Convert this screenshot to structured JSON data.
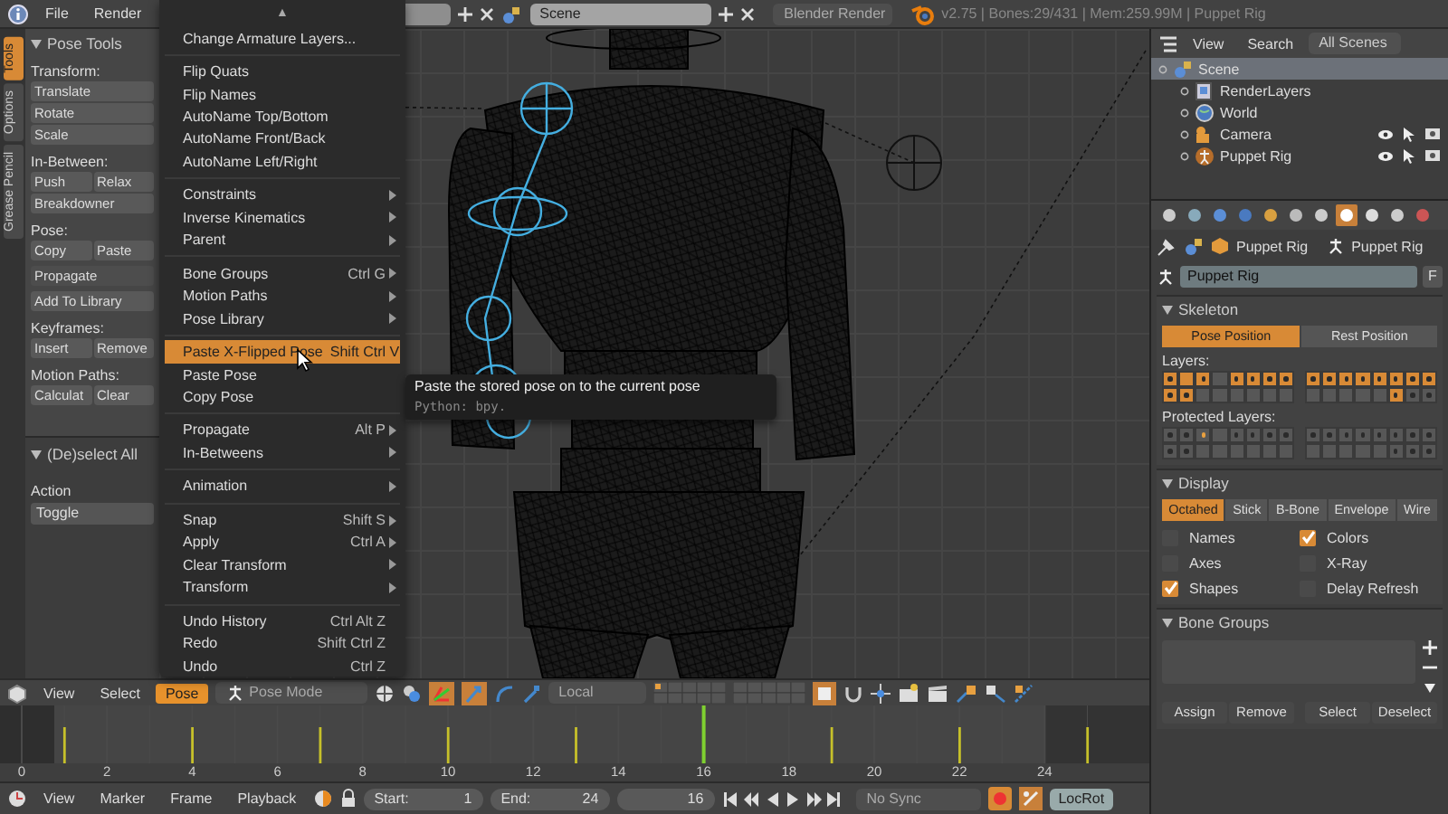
{
  "top_bar": {
    "menus": [
      "File",
      "Render"
    ],
    "scene": "Scene",
    "render_engine": "Blender Render",
    "stats": "v2.75 | Bones:29/431 | Mem:259.99M | Puppet Rig"
  },
  "tool_shelf": {
    "tabs": [
      {
        "label": "Tools",
        "selected": true
      },
      {
        "label": "Options",
        "selected": false
      },
      {
        "label": "Grease Pencil",
        "selected": false
      }
    ],
    "title": "Pose Tools",
    "sections": [
      {
        "label": "Transform:",
        "rows": [
          {
            "kind": "buttons",
            "buttons": [
              "Translate"
            ]
          },
          {
            "kind": "buttons",
            "buttons": [
              "Rotate"
            ]
          },
          {
            "kind": "buttons",
            "buttons": [
              "Scale"
            ]
          }
        ]
      },
      {
        "label": "In-Between:",
        "rows": [
          {
            "kind": "buttons",
            "buttons": [
              "Push",
              "Relax"
            ]
          },
          {
            "kind": "buttons",
            "buttons": [
              "Breakdowner"
            ]
          }
        ]
      },
      {
        "label": "Pose:",
        "rows": [
          {
            "kind": "buttons",
            "buttons": [
              "Copy",
              "Paste"
            ]
          },
          {
            "kind": "dropdown",
            "buttons": [
              "Propagate"
            ]
          },
          {
            "kind": "buttons",
            "buttons": [
              "Add To Library"
            ]
          }
        ]
      },
      {
        "label": "Keyframes:",
        "rows": [
          {
            "kind": "buttons",
            "buttons": [
              "Insert",
              "Remove"
            ]
          }
        ]
      },
      {
        "label": "Motion Paths:",
        "rows": [
          {
            "kind": "buttons",
            "buttons": [
              "Calculat",
              "Clear"
            ]
          }
        ]
      }
    ]
  },
  "operator_panel": {
    "title": "(De)select All",
    "property": "Action",
    "value": "Toggle"
  },
  "pose_menu": {
    "scroll_arrow": "▲",
    "groups": [
      [
        {
          "label": "Change Armature Layers...",
          "submenu": false,
          "selected": false
        }
      ],
      [
        {
          "label": "Flip Quats",
          "submenu": false,
          "selected": false
        },
        {
          "label": "Flip Names",
          "submenu": false,
          "selected": false
        },
        {
          "label": "AutoName Top/Bottom",
          "submenu": false,
          "selected": false
        },
        {
          "label": "AutoName Front/Back",
          "submenu": false,
          "selected": false
        },
        {
          "label": "AutoName Left/Right",
          "submenu": false,
          "selected": false
        }
      ],
      [
        {
          "label": "Constraints",
          "submenu": true,
          "selected": false
        },
        {
          "label": "Inverse Kinematics",
          "submenu": true,
          "selected": false
        },
        {
          "label": "Parent",
          "submenu": true,
          "selected": false
        }
      ],
      [
        {
          "label": "Bone Groups",
          "shortcut": "Ctrl G",
          "submenu": true,
          "selected": false
        },
        {
          "label": "Motion Paths",
          "submenu": true,
          "selected": false
        },
        {
          "label": "Pose Library",
          "submenu": true,
          "selected": false
        }
      ],
      [
        {
          "label": "Paste X-Flipped Pose",
          "shortcut": "Shift Ctrl V",
          "submenu": false,
          "selected": true
        },
        {
          "label": "Paste Pose",
          "submenu": false,
          "selected": false
        },
        {
          "label": "Copy Pose",
          "submenu": false,
          "selected": false
        }
      ],
      [
        {
          "label": "Propagate",
          "shortcut": "Alt P",
          "submenu": true,
          "selected": false
        },
        {
          "label": "In-Betweens",
          "submenu": true,
          "selected": false
        }
      ],
      [
        {
          "label": "Animation",
          "submenu": true,
          "selected": false
        }
      ],
      [
        {
          "label": "Snap",
          "shortcut": "Shift S",
          "submenu": true,
          "selected": false
        },
        {
          "label": "Apply",
          "shortcut": "Ctrl A",
          "submenu": true,
          "selected": false
        },
        {
          "label": "Clear Transform",
          "submenu": true,
          "selected": false
        },
        {
          "label": "Transform",
          "submenu": true,
          "selected": false
        }
      ],
      [
        {
          "label": "Undo History",
          "shortcut": "Ctrl Alt Z",
          "submenu": false,
          "selected": false
        },
        {
          "label": "Redo",
          "shortcut": "Shift Ctrl Z",
          "submenu": false,
          "selected": false
        },
        {
          "label": "Undo",
          "shortcut": "Ctrl Z",
          "submenu": false,
          "selected": false
        }
      ]
    ]
  },
  "tooltip": {
    "text": "Paste the stored pose on to the current pose",
    "python": "Python: bpy."
  },
  "view3d_header": {
    "menus": [
      {
        "label": "View",
        "open": false
      },
      {
        "label": "Select",
        "open": false
      },
      {
        "label": "Pose",
        "open": true
      }
    ],
    "mode": "Pose Mode",
    "orientation": "Local"
  },
  "timeline": {
    "ruler": [
      "0",
      "2",
      "4",
      "6",
      "8",
      "10",
      "12",
      "14",
      "16",
      "18",
      "20",
      "22",
      "24"
    ]
  },
  "timeline_header": {
    "menus": [
      "View",
      "Marker",
      "Frame",
      "Playback"
    ],
    "start_label": "Start:",
    "start": "1",
    "end_label": "End:",
    "end": "24",
    "current": "16",
    "sync": "No Sync",
    "auto_key": true,
    "keying_set": "LocRot"
  },
  "outliner": {
    "menus": [
      "View",
      "Search"
    ],
    "display": "All Scenes",
    "tree": [
      {
        "label": "Scene",
        "kind": "scene",
        "selected": true,
        "children": [
          {
            "label": "RenderLayers",
            "kind": "renderlayers",
            "selected": false
          },
          {
            "label": "World",
            "kind": "world",
            "selected": false
          },
          {
            "label": "Camera",
            "kind": "camera",
            "selected": false
          },
          {
            "label": "Puppet Rig",
            "kind": "armature",
            "selected": false
          }
        ]
      }
    ]
  },
  "properties": {
    "tabs": [
      {
        "selected": false
      },
      {
        "selected": false
      },
      {
        "selected": false
      },
      {
        "selected": false
      },
      {
        "selected": false
      },
      {
        "selected": false
      },
      {
        "selected": false
      },
      {
        "selected": true
      },
      {
        "selected": false
      },
      {
        "selected": false
      },
      {
        "selected": false
      }
    ],
    "breadcrumb": [
      "Puppet Rig",
      "Puppet Rig"
    ],
    "datablock": "Puppet Rig",
    "fake_user": "F",
    "skeleton": {
      "title": "Skeleton",
      "positions": [
        {
          "label": "Pose Position",
          "selected": true
        },
        {
          "label": "Rest Position",
          "selected": false
        }
      ],
      "layers_label": "Layers:",
      "layers": [
        [
          {
            "selected": true,
            "has_bones": true
          },
          {
            "selected": true,
            "has_bones": false
          },
          {
            "selected": true,
            "has_bones": true
          },
          {
            "selected": false,
            "has_bones": false
          },
          {
            "selected": true,
            "has_bones": true
          },
          {
            "selected": true,
            "has_bones": true
          },
          {
            "selected": true,
            "has_bones": true
          },
          {
            "selected": true,
            "has_bones": true
          },
          {
            "selected": true,
            "has_bones": true
          },
          {
            "selected": true,
            "has_bones": true
          },
          {
            "selected": true,
            "has_bones": true
          },
          {
            "selected": true,
            "has_bones": true
          },
          {
            "selected": true,
            "has_bones": true
          },
          {
            "selected": true,
            "has_bones": true
          },
          {
            "selected": true,
            "has_bones": true
          },
          {
            "selected": true,
            "has_bones": true
          }
        ],
        [
          {
            "selected": true,
            "has_bones": true
          },
          {
            "selected": true,
            "has_bones": true
          },
          {
            "selected": false,
            "has_bones": false
          },
          {
            "selected": false,
            "has_bones": false
          },
          {
            "selected": false,
            "has_bones": false
          },
          {
            "selected": false,
            "has_bones": false
          },
          {
            "selected": false,
            "has_bones": false
          },
          {
            "selected": false,
            "has_bones": false
          },
          {
            "selected": false,
            "has_bones": false
          },
          {
            "selected": false,
            "has_bones": false
          },
          {
            "selected": false,
            "has_bones": false
          },
          {
            "selected": false,
            "has_bones": false
          },
          {
            "selected": false,
            "has_bones": false
          },
          {
            "selected": true,
            "has_bones": true
          },
          {
            "selected": false,
            "has_bones": true
          },
          {
            "selected": false,
            "has_bones": true
          }
        ]
      ],
      "protected_label": "Protected Layers:",
      "protected_layers": [
        [
          {
            "protected": false,
            "has_bones": true
          },
          {
            "protected": false,
            "has_bones": true
          },
          {
            "protected": true,
            "has_bones": true
          },
          {
            "protected": false,
            "has_bones": false
          },
          {
            "protected": false,
            "has_bones": true
          },
          {
            "protected": false,
            "has_bones": true
          },
          {
            "protected": false,
            "has_bones": true
          },
          {
            "protected": false,
            "has_bones": true
          },
          {
            "protected": false,
            "has_bones": true
          },
          {
            "protected": false,
            "has_bones": true
          },
          {
            "protected": false,
            "has_bones": true
          },
          {
            "protected": false,
            "has_bones": true
          },
          {
            "protected": false,
            "has_bones": true
          },
          {
            "protected": false,
            "has_bones": true
          },
          {
            "protected": false,
            "has_bones": true
          },
          {
            "protected": false,
            "has_bones": true
          }
        ],
        [
          {
            "protected": false,
            "has_bones": true
          },
          {
            "protected": false,
            "has_bones": true
          },
          {
            "protected": false,
            "has_bones": false
          },
          {
            "protected": false,
            "has_bones": false
          },
          {
            "protected": false,
            "has_bones": false
          },
          {
            "protected": false,
            "has_bones": false
          },
          {
            "protected": false,
            "has_bones": false
          },
          {
            "protected": false,
            "has_bones": false
          },
          {
            "protected": false,
            "has_bones": false
          },
          {
            "protected": false,
            "has_bones": false
          },
          {
            "protected": false,
            "has_bones": false
          },
          {
            "protected": false,
            "has_bones": false
          },
          {
            "protected": false,
            "has_bones": false
          },
          {
            "protected": false,
            "has_bones": true
          },
          {
            "protected": false,
            "has_bones": true
          },
          {
            "protected": false,
            "has_bones": true
          }
        ]
      ]
    },
    "display": {
      "title": "Display",
      "types": [
        {
          "label": "Octahed",
          "selected": true
        },
        {
          "label": "Stick",
          "selected": false
        },
        {
          "label": "B-Bone",
          "selected": false
        },
        {
          "label": "Envelope",
          "selected": false
        },
        {
          "label": "Wire",
          "selected": false
        }
      ],
      "options": [
        {
          "label": "Names",
          "checked": false
        },
        {
          "label": "Colors",
          "checked": true
        },
        {
          "label": "Axes",
          "checked": false
        },
        {
          "label": "X-Ray",
          "checked": false
        },
        {
          "label": "Shapes",
          "checked": true
        },
        {
          "label": "Delay Refresh",
          "checked": false
        }
      ]
    },
    "bone_groups": {
      "title": "Bone Groups",
      "buttons": [
        "Assign",
        "Remove",
        "Select",
        "Deselect"
      ]
    }
  }
}
